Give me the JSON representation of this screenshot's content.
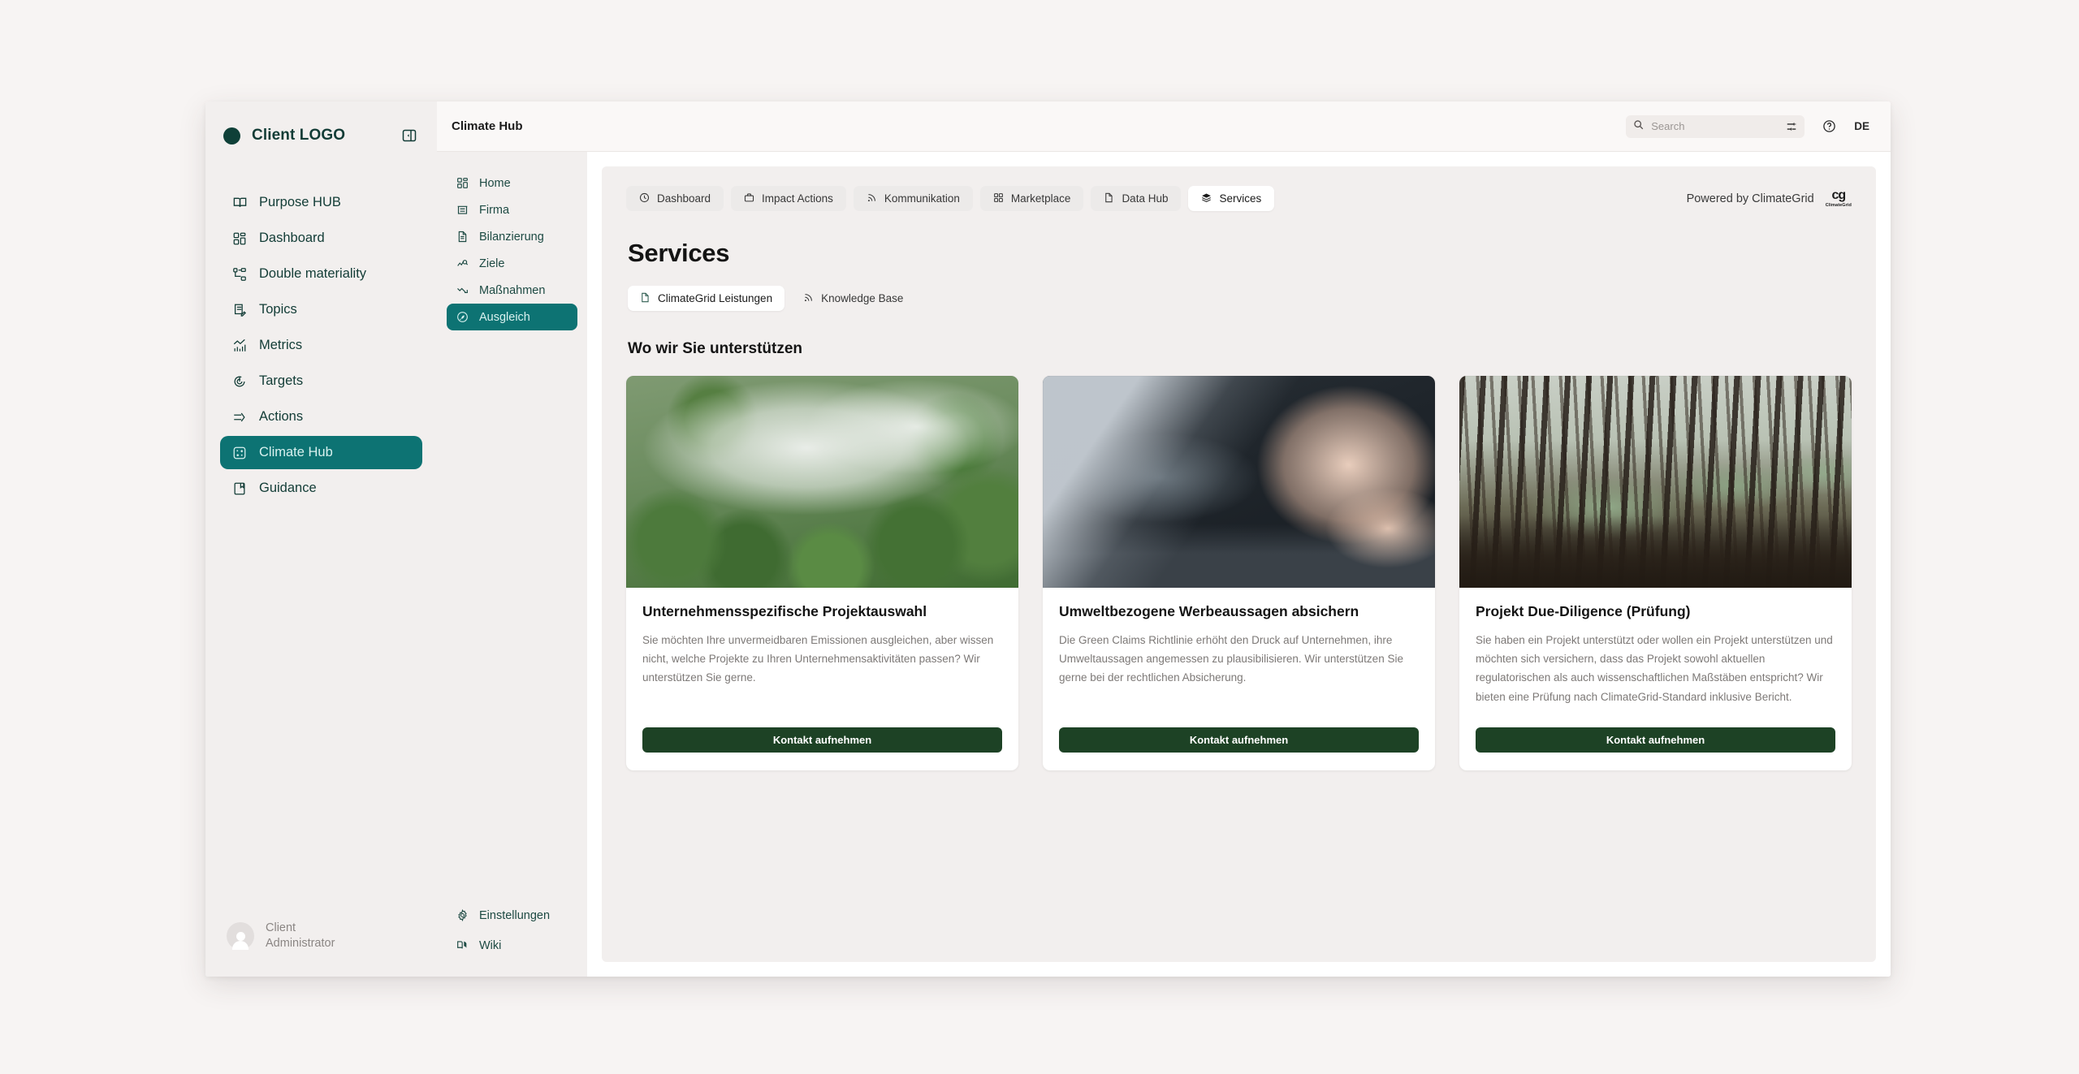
{
  "sidebar": {
    "brand": "Client LOGO",
    "collapse_icon": "panel-collapse-icon",
    "items": [
      {
        "label": "Purpose HUB",
        "icon": "book-icon"
      },
      {
        "label": "Dashboard",
        "icon": "dashboard-grid-icon"
      },
      {
        "label": "Double materiality",
        "icon": "nodes-icon"
      },
      {
        "label": "Topics",
        "icon": "document-edit-icon"
      },
      {
        "label": "Metrics",
        "icon": "chart-bars-icon"
      },
      {
        "label": "Targets",
        "icon": "target-icon"
      },
      {
        "label": "Actions",
        "icon": "actions-arrow-icon"
      },
      {
        "label": "Climate Hub",
        "icon": "climate-hub-icon"
      },
      {
        "label": "Guidance",
        "icon": "bookmark-page-icon"
      }
    ],
    "active_item": "Climate Hub",
    "user": {
      "line1": "Client",
      "line2": "Administrator"
    }
  },
  "topbar": {
    "title": "Climate Hub",
    "search": {
      "placeholder": "Search",
      "value": "",
      "icon": "search-icon"
    },
    "filter_icon": "sliders-icon",
    "help_icon": "question-circle-icon",
    "language": "DE"
  },
  "subnav": {
    "items": [
      {
        "label": "Home",
        "icon": "dashboard-grid-icon"
      },
      {
        "label": "Firma",
        "icon": "store-icon"
      },
      {
        "label": "Bilanzierung",
        "icon": "document-icon"
      },
      {
        "label": "Ziele",
        "icon": "trend-search-icon"
      },
      {
        "label": "Maßnahmen",
        "icon": "trend-down-icon"
      },
      {
        "label": "Ausgleich",
        "icon": "leaf-refresh-icon"
      }
    ],
    "active_item": "Ausgleich",
    "bottom_items": [
      {
        "label": "Einstellungen",
        "icon": "gear-icon"
      },
      {
        "label": "Wiki",
        "icon": "book-open-icon"
      }
    ]
  },
  "main": {
    "tabs": [
      {
        "label": "Dashboard",
        "icon": "clock-icon",
        "active": false
      },
      {
        "label": "Impact Actions",
        "icon": "briefcase-icon",
        "active": false
      },
      {
        "label": "Kommunikation",
        "icon": "rss-icon",
        "active": false
      },
      {
        "label": "Marketplace",
        "icon": "grid-icon",
        "active": false
      },
      {
        "label": "Data Hub",
        "icon": "document-icon",
        "active": false
      },
      {
        "label": "Services",
        "icon": "layers-icon",
        "active": true
      }
    ],
    "powered_by": "Powered by ClimateGrid",
    "logo_mark": "cg",
    "logo_sub": "ClimateGrid",
    "page_title": "Services",
    "subtabs": [
      {
        "label": "ClimateGrid Leistungen",
        "icon": "document-icon",
        "active": true
      },
      {
        "label": "Knowledge Base",
        "icon": "rss-icon",
        "active": false
      }
    ],
    "section_title": "Wo wir Sie unterstützen",
    "cards": [
      {
        "image": "rainforest-mist-photo",
        "title": "Unternehmensspezifische Projektauswahl",
        "text": "Sie möchten Ihre unvermeidbaren Emissionen ausgleichen, aber wissen nicht, welche Projekte zu Ihren Unternehmensaktivitäten passen? Wir unterstützen Sie gerne.",
        "button": "Kontakt aufnehmen"
      },
      {
        "image": "laptop-hands-photo",
        "title": "Umweltbezogene Werbeaussagen absichern",
        "text": "Die Green Claims Richtlinie erhöht den Druck auf Unternehmen, ihre Umweltaussagen angemessen zu plausibilisieren. Wir unterstützen Sie gerne bei der rechtlichen Absicherung.",
        "button": "Kontakt aufnehmen"
      },
      {
        "image": "forest-trees-ferns-photo",
        "title": "Projekt Due-Diligence (Prüfung)",
        "text": "Sie haben ein Projekt unterstützt oder wollen ein Projekt unterstützen und möchten sich versichern, dass das Projekt sowohl aktuellen regulatorischen als auch wissenschaftlichen Maßstäben entspricht? Wir bieten eine Prüfung nach ClimateGrid-Standard inklusive Bericht.",
        "button": "Kontakt aufnehmen"
      }
    ]
  },
  "colors": {
    "accent_teal": "#0d7373",
    "brand_dark_green": "#0f4038",
    "button_green": "#1d4225",
    "page_bg": "#f7f4f3",
    "panel_bg": "#f2efee"
  }
}
